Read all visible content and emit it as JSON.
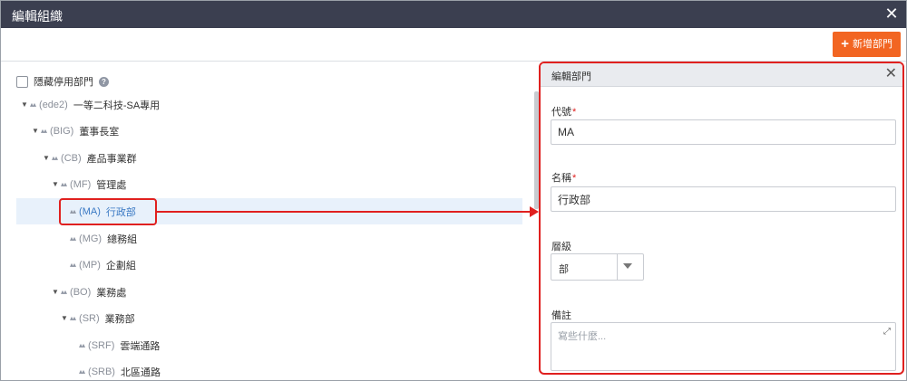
{
  "window": {
    "title": "編輯組織",
    "close_icon": "close-icon"
  },
  "toolbar": {
    "add_label": "新增部門",
    "add_color": "#f26522"
  },
  "tree": {
    "hide_disabled_label": "隱藏停用部門",
    "nodes": [
      {
        "code": "(ede2)",
        "name": "一等二科技-SA專用",
        "expanded": true
      },
      {
        "code": "(BIG)",
        "name": "董事長室",
        "expanded": true
      },
      {
        "code": "(CB)",
        "name": "產品事業群",
        "expanded": true
      },
      {
        "code": "(MF)",
        "name": "管理處",
        "expanded": true
      },
      {
        "code": "(MA)",
        "name": "行政部",
        "selected": true
      },
      {
        "code": "(MG)",
        "name": "總務組"
      },
      {
        "code": "(MP)",
        "name": "企劃組"
      },
      {
        "code": "(BO)",
        "name": "業務處",
        "expanded": true
      },
      {
        "code": "(SR)",
        "name": "業務部",
        "expanded": true
      },
      {
        "code": "(SRF)",
        "name": "雲端通路"
      },
      {
        "code": "(SRB)",
        "name": "北區通路"
      }
    ]
  },
  "panel": {
    "title": "編輯部門",
    "code_label": "代號",
    "code_value": "MA",
    "name_label": "名稱",
    "name_value": "行政部",
    "level_label": "層級",
    "level_value": "部",
    "note_label": "備註",
    "note_placeholder": "寫些什麼..."
  },
  "colors": {
    "titlebar": "#3b3f50",
    "highlight": "#e0201f",
    "selected_text": "#3a79c4"
  }
}
